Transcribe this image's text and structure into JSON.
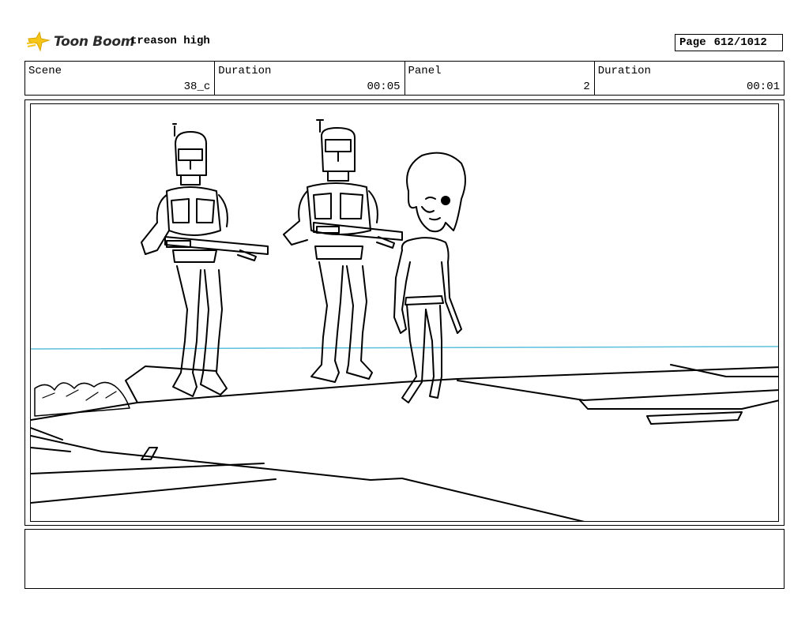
{
  "header": {
    "logo_text": "Toon Boom",
    "project_title": "treason high",
    "page_label": "Page",
    "page_value": "612/1012"
  },
  "info": {
    "scene_label": "Scene",
    "scene_value": "38_c",
    "duration_label": "Duration",
    "duration_value": "00:05",
    "panel_label": "Panel",
    "panel_value": "2",
    "panel_duration_label": "Duration",
    "panel_duration_value": "00:01"
  },
  "notes": {
    "text": ""
  },
  "colors": {
    "horizon_line": "#5bc0de",
    "logo_accent": "#f5c518"
  }
}
